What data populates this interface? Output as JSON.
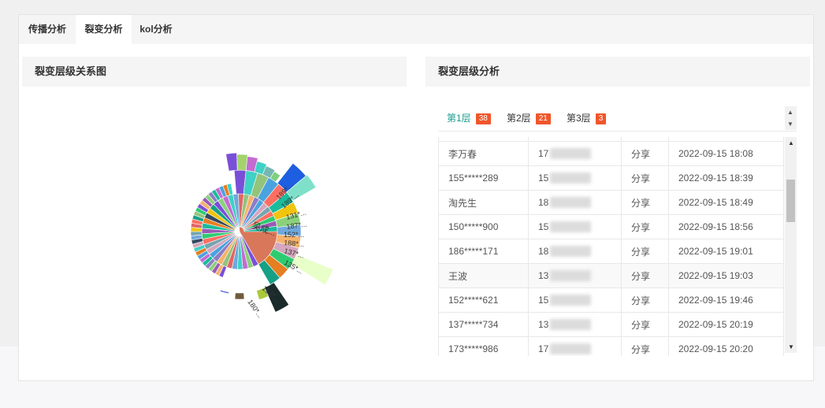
{
  "tabs": [
    "传播分析",
    "裂变分析",
    "kol分析"
  ],
  "left_panel": {
    "title": "裂变层级关系图"
  },
  "chart_data": {
    "type": "sunburst",
    "center_label": "吴成...",
    "ring_labels": [
      "158*...",
      "180*...",
      "189*...",
      "189*...",
      "131*...",
      "187*...",
      "152*...",
      "188*...",
      "137*...",
      "135*...",
      "152*...",
      "180*..."
    ]
  },
  "right_panel": {
    "title": "裂变层级分析"
  },
  "levels": [
    {
      "label": "第1层",
      "count": "38"
    },
    {
      "label": "第2层",
      "count": "21"
    },
    {
      "label": "第3层",
      "count": "3"
    }
  ],
  "rows": [
    {
      "name": "李万春",
      "phone": "17",
      "action": "分享",
      "time": "2022-09-15 18:08"
    },
    {
      "name": "155*****289",
      "phone": "15",
      "action": "分享",
      "time": "2022-09-15 18:39"
    },
    {
      "name": "淘先生",
      "phone": "18",
      "action": "分享",
      "time": "2022-09-15 18:49"
    },
    {
      "name": "150*****900",
      "phone": "15",
      "action": "分享",
      "time": "2022-09-15 18:56"
    },
    {
      "name": "186*****171",
      "phone": "18",
      "action": "分享",
      "time": "2022-09-15 19:01"
    },
    {
      "name": "王波",
      "phone": "13",
      "action": "分享",
      "time": "2022-09-15 19:03"
    },
    {
      "name": "152*****621",
      "phone": "15",
      "action": "分享",
      "time": "2022-09-15 19:46"
    },
    {
      "name": "137*****734",
      "phone": "13",
      "action": "分享",
      "time": "2022-09-15 20:19"
    },
    {
      "name": "173*****986",
      "phone": "17",
      "action": "分享",
      "time": "2022-09-15 20:20"
    }
  ],
  "colors": {
    "accent": "#1a9c8e",
    "badge": "#f0562b",
    "center": "#d9775a"
  }
}
